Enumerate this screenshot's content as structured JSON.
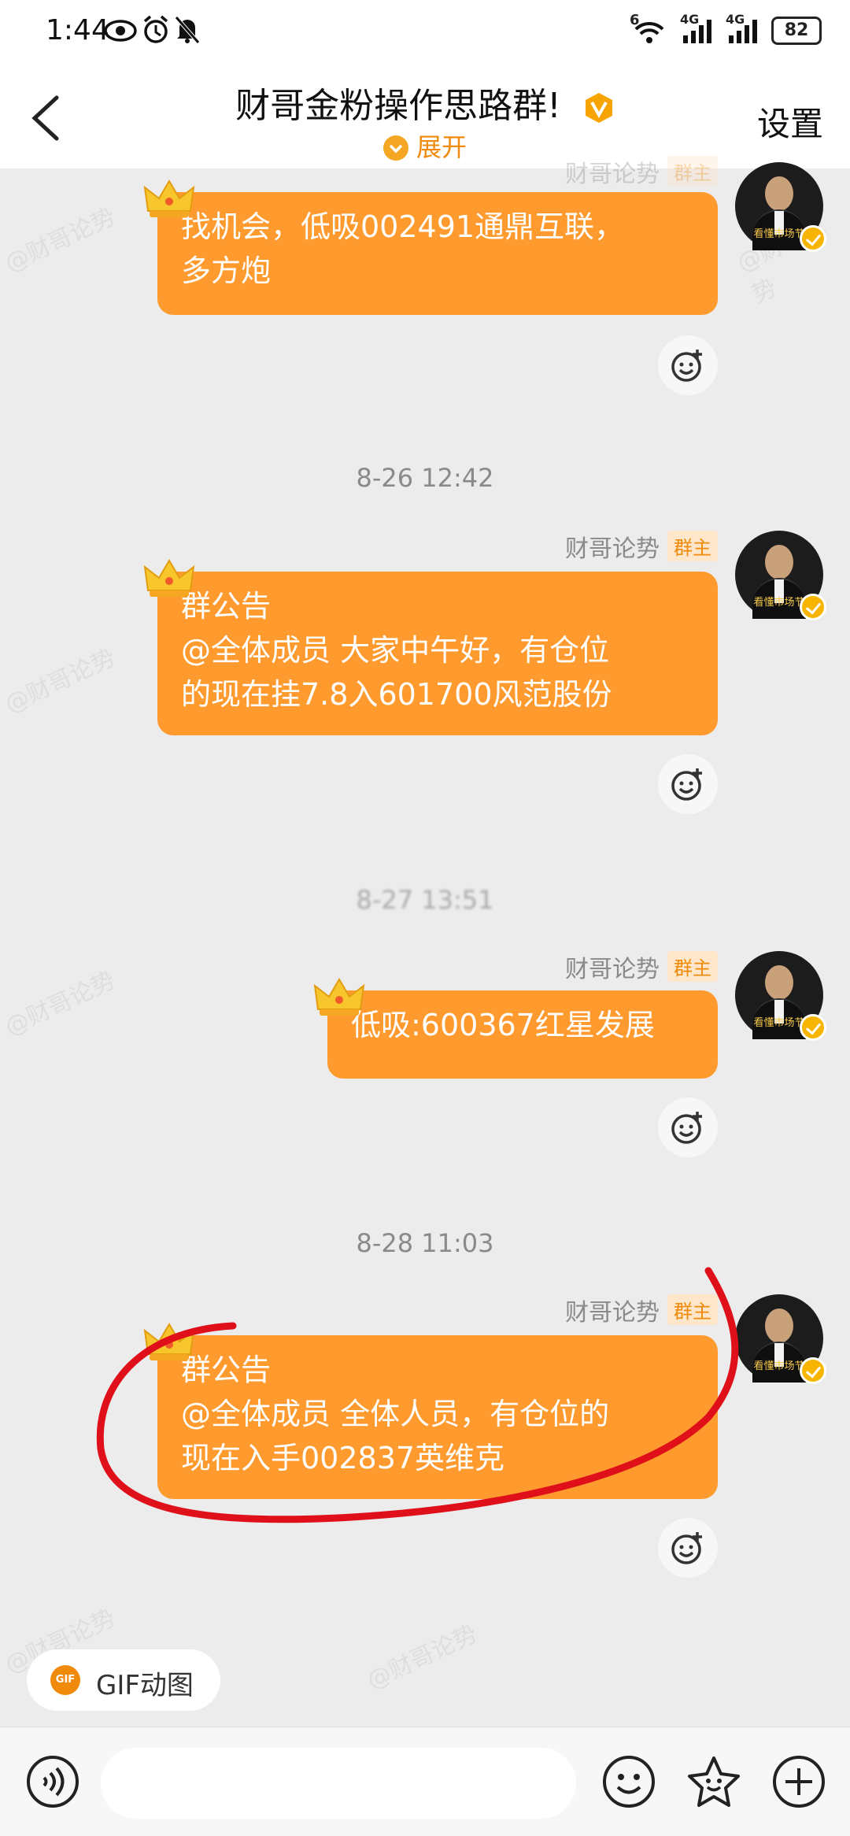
{
  "status_bar": {
    "time": "1:44",
    "battery": "82",
    "network_1": "4G",
    "network_2": "4G",
    "wifi_badge": "6"
  },
  "header": {
    "title": "财哥金粉操作思路群!",
    "expand_label": "展开",
    "settings_label": "设置"
  },
  "messages": [
    {
      "sender": "财哥论势",
      "role": "群主",
      "lines": [
        "找机会，低吸002491通鼎互联，",
        "多方炮"
      ],
      "avatar_caption": "看懂市场节"
    },
    {
      "timestamp": "8-26 12:42",
      "sender": "财哥论势",
      "role": "群主",
      "lines": [
        "群公告",
        "@全体成员 大家中午好，有仓位",
        "的现在挂7.8入601700风范股份"
      ],
      "avatar_caption": "看懂市场节"
    },
    {
      "timestamp": "8-27 13:51",
      "sender": "财哥论势",
      "role": "群主",
      "lines": [
        "低吸:600367红星发展"
      ],
      "avatar_caption": "看懂市场节"
    },
    {
      "timestamp": "8-28 11:03",
      "sender": "财哥论势",
      "role": "群主",
      "lines": [
        "群公告",
        "@全体成员 全体人员，有仓位的",
        "现在入手002837英维克"
      ],
      "avatar_caption": "看懂市场节"
    }
  ],
  "watermark_text": "@财哥论势",
  "gif_chip": {
    "icon_text": "GIF",
    "label": "GIF动图"
  },
  "colors": {
    "bubble": "#ff9a2e",
    "accent": "#f08a0b",
    "annotation": "#e0101a"
  },
  "icons": [
    "eye-icon",
    "alarm-icon",
    "mute-icon",
    "wifi-icon",
    "signal-icon",
    "voice-icon",
    "emoji-icon",
    "sticker-icon",
    "plus-icon"
  ]
}
